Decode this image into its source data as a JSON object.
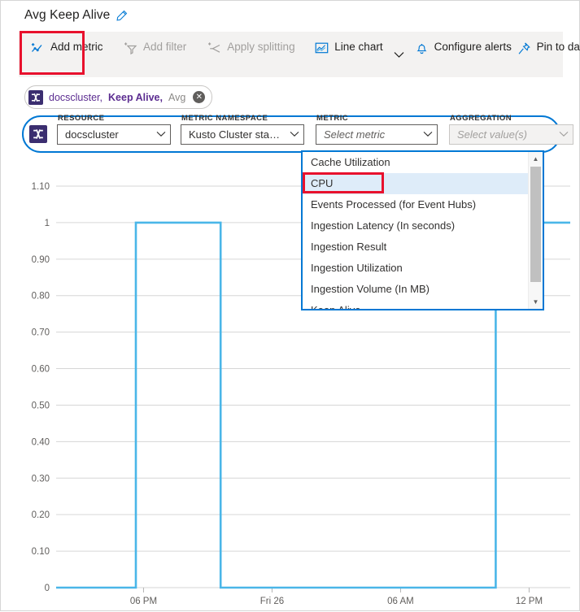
{
  "header": {
    "title": "Avg Keep Alive",
    "edit_icon": "pencil-icon"
  },
  "command_bar": {
    "items": [
      {
        "label": "Add metric",
        "icon": "add-metric-icon",
        "disabled": false
      },
      {
        "label": "Add filter",
        "icon": "add-filter-icon",
        "disabled": true
      },
      {
        "label": "Apply splitting",
        "icon": "apply-splitting-icon",
        "disabled": true
      },
      {
        "label": "Line chart",
        "icon": "line-chart-icon",
        "disabled": false
      },
      {
        "label": "Configure alerts",
        "icon": "bell-icon",
        "disabled": false
      },
      {
        "label": "Pin to dashboard",
        "icon": "pin-icon",
        "disabled": false
      }
    ],
    "overflow_label": "•••",
    "chart_type_chevron": "chevron-down-icon"
  },
  "metric_chip": {
    "resource": "docscluster,",
    "metric": "Keep Alive,",
    "aggregation": "Avg",
    "remove_label": "✕",
    "badge_icon": "kusto-cluster-icon"
  },
  "selector": {
    "badge_icon": "kusto-cluster-icon",
    "fields": [
      {
        "label": "RESOURCE",
        "value": "docscluster",
        "placeholder": false,
        "disabled": false
      },
      {
        "label": "METRIC NAMESPACE",
        "value": "Kusto Cluster stand...",
        "placeholder": false,
        "disabled": false
      },
      {
        "label": "METRIC",
        "value": "Select metric",
        "placeholder": true,
        "disabled": false
      },
      {
        "label": "AGGREGATION",
        "value": "Select value(s)",
        "placeholder": true,
        "disabled": true
      }
    ],
    "remove_label": "✕"
  },
  "dropdown": {
    "options": [
      "Cache Utilization",
      "CPU",
      "Events Processed (for Event Hubs)",
      "Ingestion Latency (In seconds)",
      "Ingestion Result",
      "Ingestion Utilization",
      "Ingestion Volume (In MB)",
      "Keep Alive"
    ],
    "selected_index": 1,
    "highlighted_index": 1,
    "scroll_up_icon": "triangle-up-icon",
    "scroll_down_icon": "triangle-down-icon"
  },
  "colors": {
    "accent": "#0078d4",
    "series_line": "#4ab6e8",
    "annotation": "#e8112d",
    "chip_text": "#5c2d91",
    "badge": "#3b2e70",
    "grid": "#d6d6d6",
    "selected_row": "#deecf9"
  },
  "chart_data": {
    "type": "line",
    "title": "Avg Keep Alive",
    "xlabel": "",
    "ylabel": "",
    "grid": true,
    "legend": "none",
    "ylim": [
      0,
      1.1
    ],
    "yticks": [
      "0",
      "0.10",
      "0.20",
      "0.30",
      "0.40",
      "0.50",
      "0.60",
      "0.70",
      "0.80",
      "0.90",
      "1",
      "1.10"
    ],
    "ytick_values": [
      0,
      0.1,
      0.2,
      0.3,
      0.4,
      0.5,
      0.6,
      0.7,
      0.8,
      0.9,
      1.0,
      1.1
    ],
    "xticks": [
      "06 PM",
      "Fri 26",
      "06 AM",
      "12 PM"
    ],
    "xtick_positions": [
      0.17,
      0.42,
      0.67,
      0.92
    ],
    "series": [
      {
        "name": "docscluster, Keep Alive, Avg",
        "color": "#4ab6e8",
        "x": [
          0.0,
          0.155,
          0.155,
          0.32,
          0.32,
          0.855,
          0.855,
          1.0
        ],
        "y": [
          0,
          0,
          1,
          1,
          0,
          0,
          1,
          1
        ]
      }
    ],
    "description": "Step/pulse series: value is 0 most of the time with a pulse to 1 between ~05 PM-ish and Fri 26, and a rise back to 1 after 12 PM."
  }
}
